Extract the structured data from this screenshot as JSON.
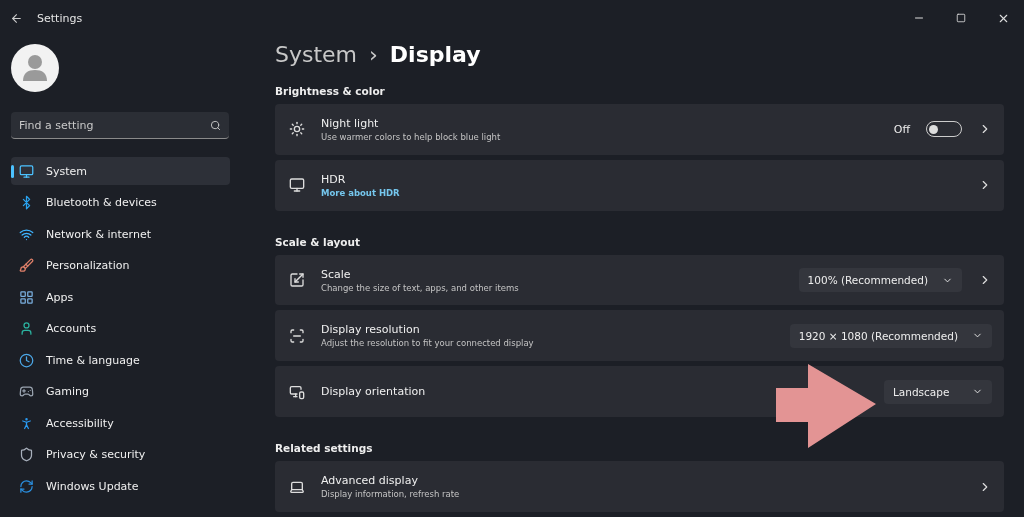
{
  "window": {
    "title": "Settings"
  },
  "search": {
    "placeholder": "Find a setting"
  },
  "sidebar": {
    "items": [
      {
        "label": "System",
        "selected": true
      },
      {
        "label": "Bluetooth & devices",
        "selected": false
      },
      {
        "label": "Network & internet",
        "selected": false
      },
      {
        "label": "Personalization",
        "selected": false
      },
      {
        "label": "Apps",
        "selected": false
      },
      {
        "label": "Accounts",
        "selected": false
      },
      {
        "label": "Time & language",
        "selected": false
      },
      {
        "label": "Gaming",
        "selected": false
      },
      {
        "label": "Accessibility",
        "selected": false
      },
      {
        "label": "Privacy & security",
        "selected": false
      },
      {
        "label": "Windows Update",
        "selected": false
      }
    ]
  },
  "breadcrumb": {
    "parent": "System",
    "separator": "›",
    "current": "Display"
  },
  "sections": [
    {
      "title": "Brightness & color",
      "rows": [
        {
          "title": "Night light",
          "description": "Use warmer colors to help block blue light",
          "control": {
            "kind": "toggle",
            "label": "Off",
            "on": false
          },
          "chevron": true
        },
        {
          "title": "HDR",
          "link": "More about HDR",
          "chevron": true
        }
      ]
    },
    {
      "title": "Scale & layout",
      "rows": [
        {
          "title": "Scale",
          "description": "Change the size of text, apps, and other items",
          "control": {
            "kind": "dropdown",
            "value": "100% (Recommended)"
          },
          "chevron": true
        },
        {
          "title": "Display resolution",
          "description": "Adjust the resolution to fit your connected display",
          "control": {
            "kind": "dropdown",
            "value": "1920 × 1080 (Recommended)"
          },
          "chevron": false
        },
        {
          "title": "Display orientation",
          "control": {
            "kind": "dropdown",
            "value": "Landscape"
          },
          "chevron": false
        }
      ]
    },
    {
      "title": "Related settings",
      "rows": [
        {
          "title": "Advanced display",
          "description": "Display information, refresh rate",
          "chevron": true
        }
      ]
    }
  ]
}
